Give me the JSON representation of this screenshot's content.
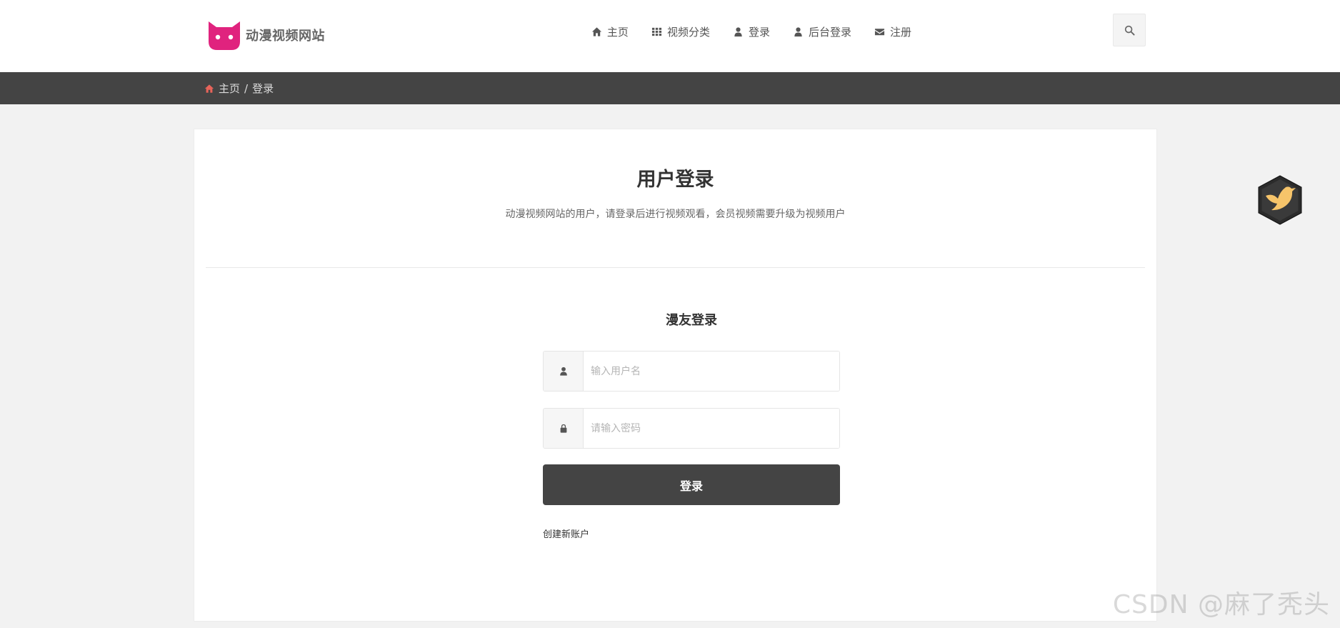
{
  "header": {
    "logo_text": "动漫视频网站",
    "nav": [
      {
        "label": "主页",
        "icon": "home-icon"
      },
      {
        "label": "视频分类",
        "icon": "grid-icon"
      },
      {
        "label": "登录",
        "icon": "user-icon"
      },
      {
        "label": "后台登录",
        "icon": "user-icon"
      },
      {
        "label": "注册",
        "icon": "envelope-icon"
      }
    ],
    "search_icon": "search-icon"
  },
  "breadcrumb": {
    "home": "主页",
    "separator": "/",
    "current": "登录"
  },
  "main": {
    "title": "用户登录",
    "subtitle": "动漫视频网站的用户，请登录后进行视频观看，会员视频需要升级为视频用户",
    "form_title": "漫友登录",
    "username_placeholder": "输入用户名",
    "password_placeholder": "请输入密码",
    "login_button": "登录",
    "create_account": "创建新账户"
  },
  "watermark": "CSDN @麻了秃头",
  "colors": {
    "brand": "#e0237e",
    "breadcrumb_bar": "#444444",
    "button": "#444444",
    "breadcrumb_home_icon": "#e8645a"
  }
}
